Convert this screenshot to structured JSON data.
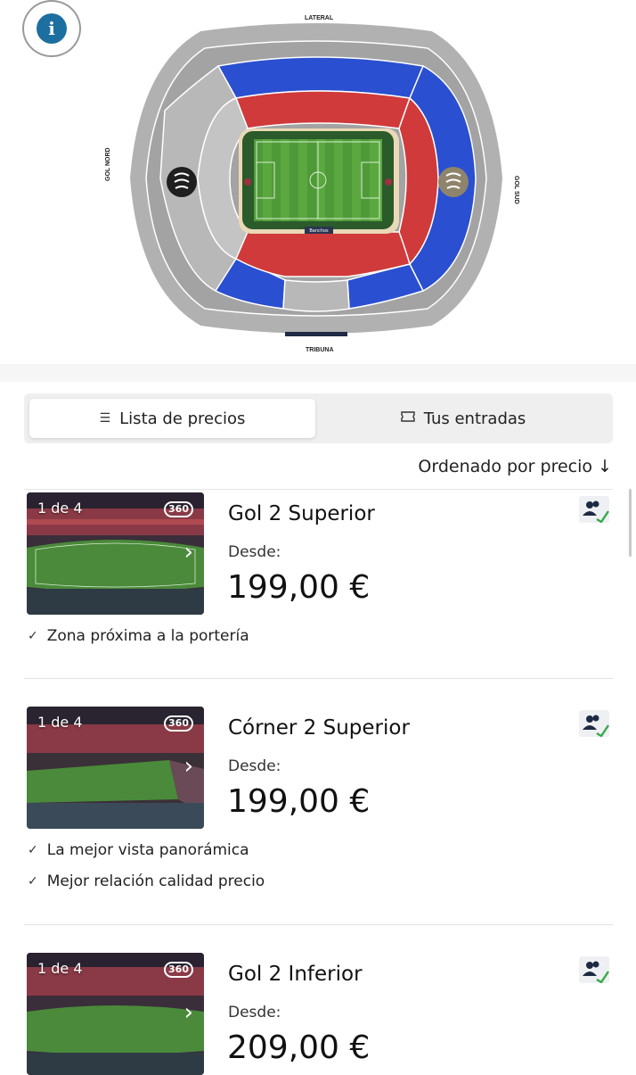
{
  "map": {
    "labels": {
      "top": "LATERAL",
      "bottom": "TRIBUNA",
      "left": "GOL NORD",
      "right": "GOL SUD",
      "benches": "Banchos"
    },
    "info_button": "i",
    "colors": {
      "upper_blue": "#2a4fd0",
      "lower_red": "#d03a3a",
      "pitch": "#4f9a3a",
      "gray_ring": "#a9a9a9"
    }
  },
  "tabs": [
    {
      "label": "Lista de precios",
      "icon": "list-icon",
      "active": true
    },
    {
      "label": "Tus entradas",
      "icon": "ticket-icon",
      "active": false
    }
  ],
  "sort": {
    "label": "Ordenado por precio ↓"
  },
  "listings": [
    {
      "photo_count": "1 de 4",
      "pano": "360",
      "next": "›",
      "title": "Gol 2 Superior",
      "from_label": "Desde:",
      "price": "199,00 €",
      "features": [
        "Zona próxima a la portería"
      ]
    },
    {
      "photo_count": "1 de 4",
      "pano": "360",
      "next": "›",
      "title": "Córner 2 Superior",
      "from_label": "Desde:",
      "price": "199,00 €",
      "features": [
        "La mejor vista panorámica",
        "Mejor relación calidad precio"
      ]
    },
    {
      "photo_count": "1 de 4",
      "pano": "360",
      "next": "›",
      "title": "Gol 2 Inferior",
      "from_label": "Desde:",
      "price": "209,00 €",
      "features": []
    }
  ]
}
